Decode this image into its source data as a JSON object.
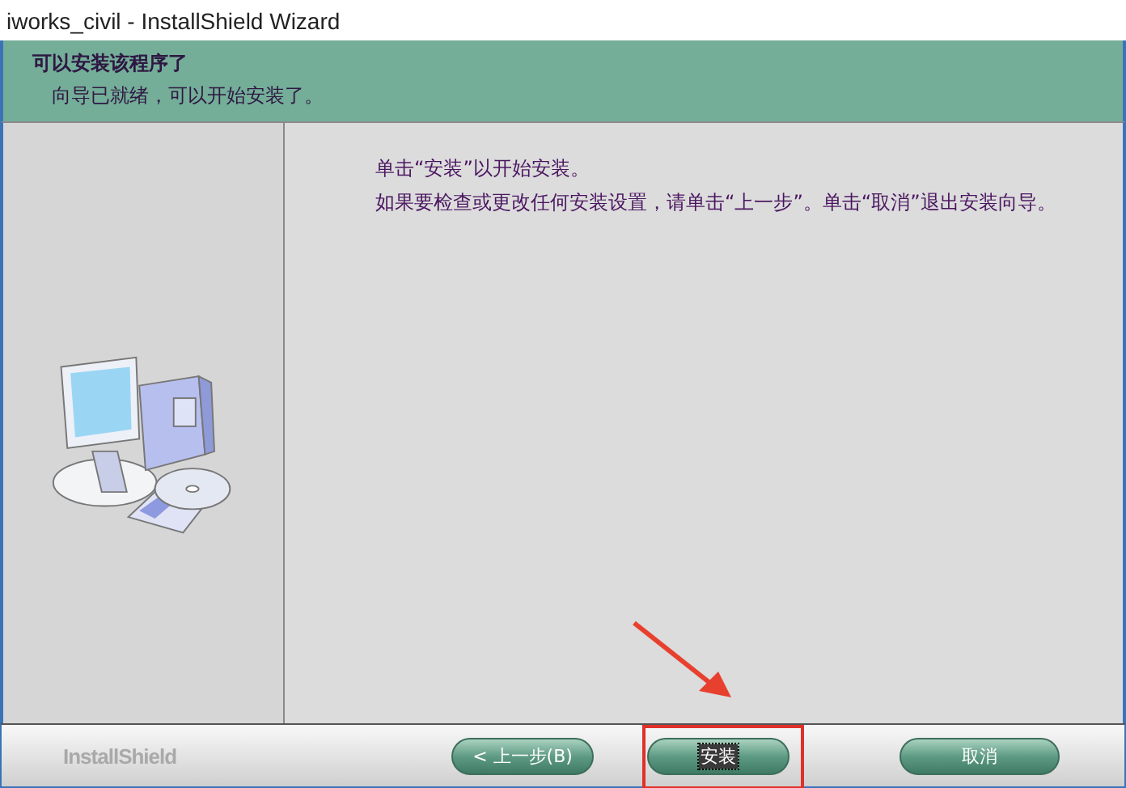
{
  "window": {
    "title": "iworks_civil - InstallShield Wizard"
  },
  "header": {
    "title": "可以安装该程序了",
    "subtitle": "向导已就绪，可以开始安装了。"
  },
  "content": {
    "paragraphs": [
      "单击“安装”以开始安装。",
      "如果要检查或更改任何安装设置，请单击“上一步”。单击“取消”退出安装向导。"
    ]
  },
  "footer": {
    "brand": "InstallShield",
    "buttons": [
      {
        "label": "< 上一步(B)",
        "focused": false,
        "highlighted": false
      },
      {
        "label": "安装",
        "focused": true,
        "highlighted": true
      },
      {
        "label": "取消",
        "focused": false,
        "highlighted": false
      }
    ]
  }
}
